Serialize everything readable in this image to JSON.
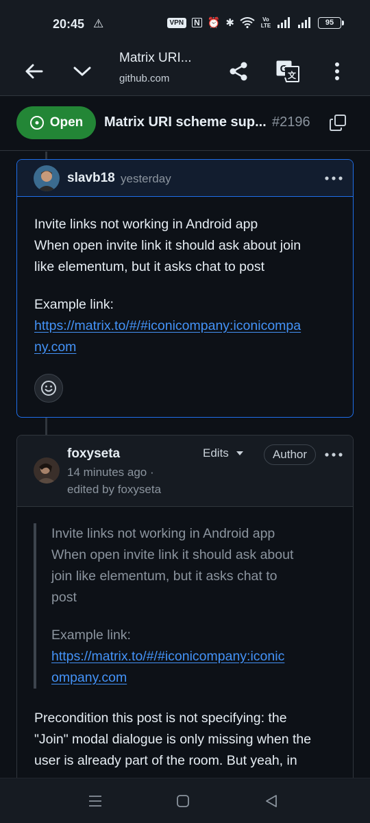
{
  "status_bar": {
    "time": "20:45",
    "alert_glyph": "⚠",
    "vpn": "VPN",
    "nfc": "N",
    "alarm": "⏰",
    "bluetooth": "✱",
    "wifi": "≋",
    "volte": "Vo LTE",
    "battery": "95"
  },
  "browser": {
    "page_title": "Matrix URI...",
    "url": "github.com",
    "icons": [
      "back-arrow-icon",
      "chevron-down-icon",
      "share-icon",
      "translate-icon",
      "more-vertical-icon"
    ]
  },
  "issue": {
    "state": "Open",
    "title": "Matrix URI scheme sup...",
    "number": "#2196",
    "state_color": "#238636"
  },
  "comments": [
    {
      "author": "slavb18",
      "time": "yesterday",
      "body": [
        "Invite links not working in Android app",
        "When open invite link it should ask about join",
        "like elementum, but it asks chat to post"
      ],
      "example_label": "Example link:",
      "link_line1": "https://matrix.to/#/#iconicompany:iconicompa",
      "link_line2": "ny.com"
    },
    {
      "author": "foxyseta",
      "edits_label": "Edits",
      "role": "Author",
      "time": "14 minutes ago ·",
      "edited_by": "edited by foxyseta",
      "quote": [
        "Invite links not working in Android app",
        "When open invite link it should ask about",
        "join like elementum, but it asks chat to",
        "post"
      ],
      "quote_example_label": "Example link:",
      "quote_link_line1": "https://matrix.to/#/#iconicompany:iconic",
      "quote_link_line2": "ompany.com",
      "reply": [
        "Precondition this post is not specifying: the",
        "\"Join\" modal dialogue is only missing when the",
        "user is already part of the room. But yeah, in"
      ]
    }
  ],
  "colors": {
    "background": "#0d1117",
    "link": "#4493f8",
    "highlight_border": "#1f6feb"
  }
}
